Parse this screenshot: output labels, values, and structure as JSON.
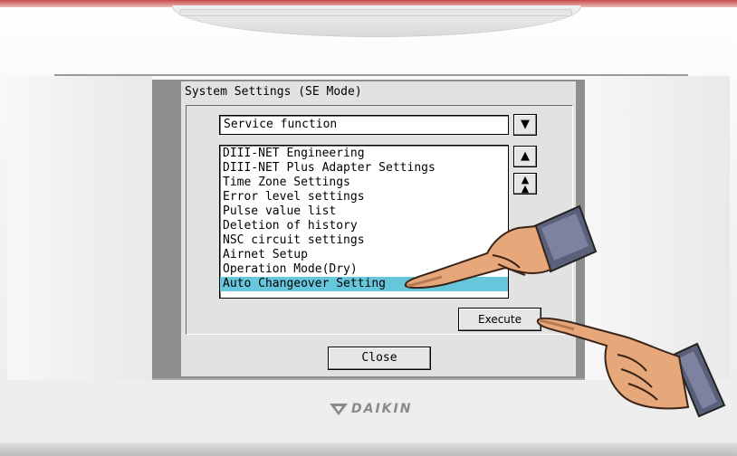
{
  "device": {
    "brand": "DAIKIN",
    "colors": {
      "bezel": "#f4f4f4",
      "screen": "#e2e2e2",
      "selection": "#66c6db",
      "accent_top": "#c64b4b"
    }
  },
  "screen": {
    "title": "System Settings (SE Mode)",
    "category_select": {
      "value": "Service function",
      "dropdown_icon": "triangle-down-icon"
    },
    "list": {
      "items": [
        "DIII-NET Engineering",
        "DIII-NET Plus Adapter Settings",
        "Time Zone Settings",
        "Error level settings",
        "Pulse value list",
        "Deletion of history",
        "NSC circuit settings",
        "Airnet Setup",
        "Operation Mode(Dry)",
        "Auto Changeover Setting"
      ],
      "selected_index": 9,
      "scroll_up_icon": "triangle-up-icon",
      "scroll_top_icon": "double-triangle-up-icon"
    },
    "execute_label": "Execute",
    "close_label": "Close"
  },
  "annotations": {
    "hand_icon": "pointing-hand-icon"
  }
}
